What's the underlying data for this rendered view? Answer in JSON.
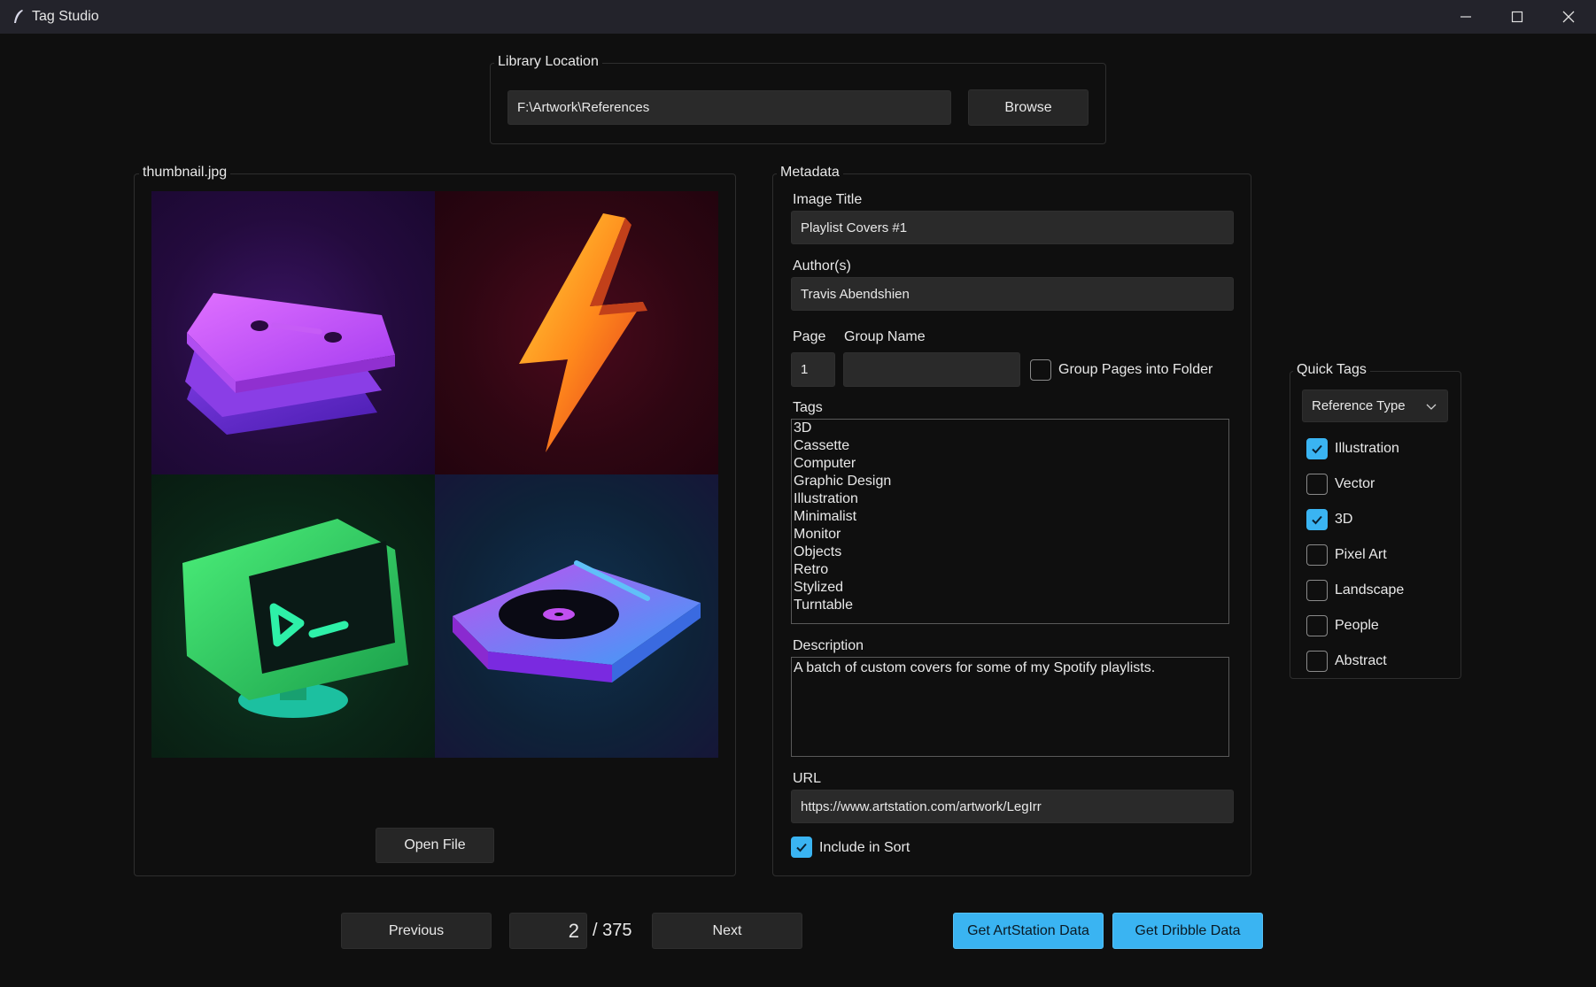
{
  "window": {
    "title": "Tag Studio"
  },
  "library": {
    "legend": "Library Location",
    "path": "F:\\Artwork\\References",
    "browse_label": "Browse"
  },
  "preview": {
    "legend": "thumbnail.jpg",
    "open_file_label": "Open File"
  },
  "metadata": {
    "legend": "Metadata",
    "image_title_label": "Image Title",
    "image_title_value": "Playlist Covers #1",
    "authors_label": "Author(s)",
    "authors_value": "Travis Abendshien",
    "page_label": "Page",
    "page_value": "1",
    "group_name_label": "Group Name",
    "group_name_value": "",
    "group_pages_label": "Group Pages into Folder",
    "group_pages_checked": false,
    "tags_label": "Tags",
    "tags": [
      "3D",
      "Cassette",
      "Computer",
      "Graphic Design",
      "Illustration",
      "Minimalist",
      "Monitor",
      "Objects",
      "Retro",
      "Stylized",
      "Turntable"
    ],
    "description_label": "Description",
    "description_value": "A batch of custom covers for some of my Spotify playlists.",
    "url_label": "URL",
    "url_value": "https://www.artstation.com/artwork/LegIrr",
    "include_in_sort_label": "Include in Sort",
    "include_in_sort_checked": true
  },
  "quick_tags": {
    "legend": "Quick Tags",
    "dropdown_value": "Reference Type",
    "items": [
      {
        "label": "Illustration",
        "checked": true
      },
      {
        "label": "Vector",
        "checked": false
      },
      {
        "label": "3D",
        "checked": true
      },
      {
        "label": "Pixel Art",
        "checked": false
      },
      {
        "label": "Landscape",
        "checked": false
      },
      {
        "label": "People",
        "checked": false
      },
      {
        "label": "Abstract",
        "checked": false
      }
    ]
  },
  "navigation": {
    "previous_label": "Previous",
    "current_page": "2",
    "total_pages": "/ 375",
    "next_label": "Next"
  },
  "actions": {
    "artstation_label": "Get ArtStation Data",
    "dribbble_label": "Get Dribble Data"
  },
  "colors": {
    "accent": "#3ab4f2",
    "background": "#0f0f0f",
    "titlebar": "#23232b"
  }
}
